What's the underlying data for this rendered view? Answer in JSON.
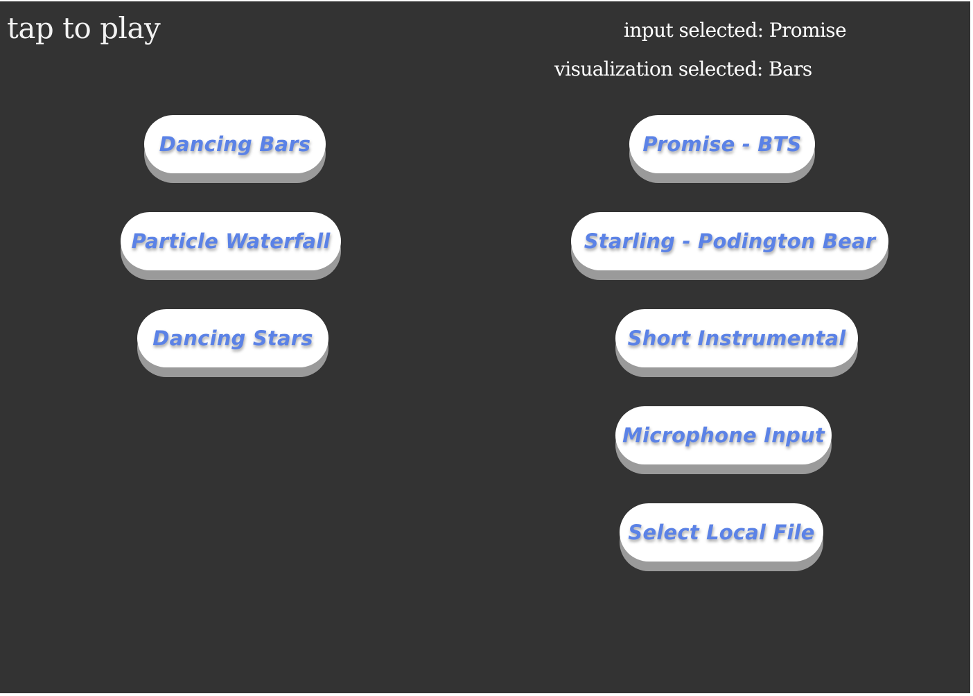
{
  "header": {
    "tap_to_play": "tap to play",
    "input_selected": "input selected: Promise",
    "visualization_selected": "visualization selected: Bars"
  },
  "visualizations": [
    {
      "label": "Dancing Bars"
    },
    {
      "label": "Particle Waterfall"
    },
    {
      "label": "Dancing Stars"
    }
  ],
  "inputs": [
    {
      "label": "Promise - BTS"
    },
    {
      "label": "Starling - Podington Bear"
    },
    {
      "label": "Short Instrumental"
    },
    {
      "label": "Microphone Input"
    },
    {
      "label": "Select Local File"
    }
  ],
  "colors": {
    "background": "#333333",
    "button": "#ffffff",
    "button_shadow": "#9a9a9a",
    "button_text": "#5b82e6"
  }
}
